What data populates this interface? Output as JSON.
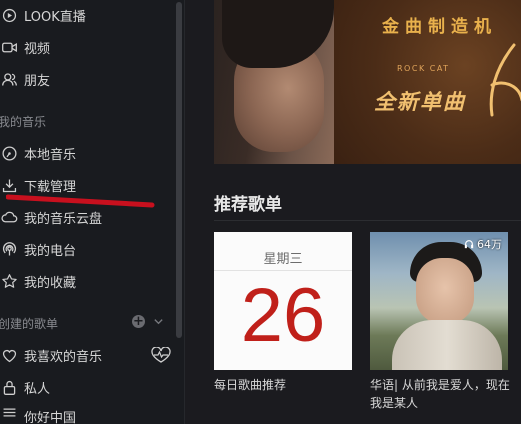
{
  "sidebar": {
    "items_top": [
      {
        "icon": "live-icon",
        "label": "LOOK直播"
      },
      {
        "icon": "video-icon",
        "label": "视频"
      },
      {
        "icon": "friends-icon",
        "label": "朋友"
      }
    ],
    "my_music_title": "我的音乐",
    "my_music": [
      {
        "icon": "local-music-icon",
        "label": "本地音乐"
      },
      {
        "icon": "download-icon",
        "label": "下载管理"
      },
      {
        "icon": "cloud-icon",
        "label": "我的音乐云盘"
      },
      {
        "icon": "radio-icon",
        "label": "我的电台"
      },
      {
        "icon": "star-icon",
        "label": "我的收藏"
      }
    ],
    "created_title": "创建的歌单",
    "created": [
      {
        "icon": "heart-icon",
        "label": "我喜欢的音乐"
      },
      {
        "icon": "lock-icon",
        "label": "私人"
      }
    ],
    "partial_bottom_label": "你好中国"
  },
  "banner": {
    "title": "金曲制造机",
    "subtitle": "ROCK CAT",
    "script": "全新单曲"
  },
  "recommend": {
    "heading": "推荐歌单",
    "cards": [
      {
        "type": "daily",
        "weekday": "星期三",
        "day": "26",
        "title": "每日歌曲推荐"
      },
      {
        "type": "playlist",
        "plays": "64万",
        "title": "华语| 从前我是爱人，现在我是某人"
      }
    ]
  },
  "colors": {
    "accent": "#c0201a",
    "annotation": "#c8101e",
    "banner_gold": "#e9b14c"
  }
}
